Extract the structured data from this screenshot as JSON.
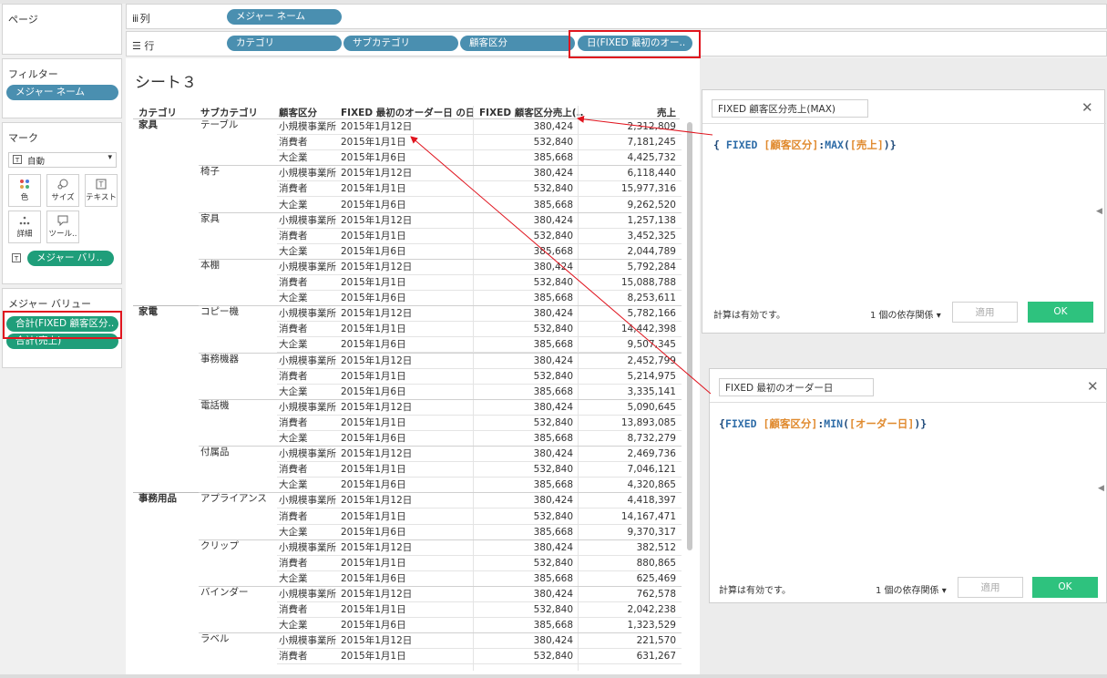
{
  "left": {
    "pages_title": "ページ",
    "filters_title": "フィルター",
    "filter_pill": "メジャー ネーム",
    "marks_title": "マーク",
    "mark_type": "自動",
    "mark_buttons": {
      "color": "色",
      "size": "サイズ",
      "text": "テキスト",
      "detail": "詳細",
      "tooltip": "ツール.."
    },
    "mark_pill": "メジャー バリ..",
    "measure_values_title": "メジャー バリュー",
    "measure_pills": [
      "合計(FIXED 顧客区分..",
      "合計(売上)"
    ]
  },
  "shelves": {
    "columns_label": "列",
    "columns_pills": [
      "メジャー ネーム"
    ],
    "rows_label": "行",
    "rows_pills": [
      "カテゴリ",
      "サブカテゴリ",
      "顧客区分",
      "日(FIXED 最初のオー.."
    ]
  },
  "sheet": {
    "title": "シート３",
    "headers": [
      "カテゴリ",
      "サブカテゴリ",
      "顧客区分",
      "FIXED 最初のオーダー日 の日",
      "FIXED 顧客区分売上(..",
      "売上"
    ],
    "categories": [
      {
        "name": "家具",
        "row": 0
      },
      {
        "name": "家電",
        "row": 12
      },
      {
        "name": "事務用品",
        "row": 24
      }
    ],
    "subcategories": [
      {
        "name": "テーブル",
        "row": 0
      },
      {
        "name": "椅子",
        "row": 3
      },
      {
        "name": "家具",
        "row": 6
      },
      {
        "name": "本棚",
        "row": 9
      },
      {
        "name": "コピー機",
        "row": 12
      },
      {
        "name": "事務機器",
        "row": 15
      },
      {
        "name": "電話機",
        "row": 18
      },
      {
        "name": "付属品",
        "row": 21
      },
      {
        "name": "アプライアンス",
        "row": 24
      },
      {
        "name": "クリップ",
        "row": 27
      },
      {
        "name": "バインダー",
        "row": 30
      },
      {
        "name": "ラベル",
        "row": 33
      }
    ],
    "rows": [
      [
        "小規模事業所",
        "2015年1月12日",
        "380,424",
        "2,312,809"
      ],
      [
        "消費者",
        "2015年1月1日",
        "532,840",
        "7,181,245"
      ],
      [
        "大企業",
        "2015年1月6日",
        "385,668",
        "4,425,732"
      ],
      [
        "小規模事業所",
        "2015年1月12日",
        "380,424",
        "6,118,440"
      ],
      [
        "消費者",
        "2015年1月1日",
        "532,840",
        "15,977,316"
      ],
      [
        "大企業",
        "2015年1月6日",
        "385,668",
        "9,262,520"
      ],
      [
        "小規模事業所",
        "2015年1月12日",
        "380,424",
        "1,257,138"
      ],
      [
        "消費者",
        "2015年1月1日",
        "532,840",
        "3,452,325"
      ],
      [
        "大企業",
        "2015年1月6日",
        "385,668",
        "2,044,789"
      ],
      [
        "小規模事業所",
        "2015年1月12日",
        "380,424",
        "5,792,284"
      ],
      [
        "消費者",
        "2015年1月1日",
        "532,840",
        "15,088,788"
      ],
      [
        "大企業",
        "2015年1月6日",
        "385,668",
        "8,253,611"
      ],
      [
        "小規模事業所",
        "2015年1月12日",
        "380,424",
        "5,782,166"
      ],
      [
        "消費者",
        "2015年1月1日",
        "532,840",
        "14,442,398"
      ],
      [
        "大企業",
        "2015年1月6日",
        "385,668",
        "9,507,345"
      ],
      [
        "小規模事業所",
        "2015年1月12日",
        "380,424",
        "2,452,799"
      ],
      [
        "消費者",
        "2015年1月1日",
        "532,840",
        "5,214,975"
      ],
      [
        "大企業",
        "2015年1月6日",
        "385,668",
        "3,335,141"
      ],
      [
        "小規模事業所",
        "2015年1月12日",
        "380,424",
        "5,090,645"
      ],
      [
        "消費者",
        "2015年1月1日",
        "532,840",
        "13,893,085"
      ],
      [
        "大企業",
        "2015年1月6日",
        "385,668",
        "8,732,279"
      ],
      [
        "小規模事業所",
        "2015年1月12日",
        "380,424",
        "2,469,736"
      ],
      [
        "消費者",
        "2015年1月1日",
        "532,840",
        "7,046,121"
      ],
      [
        "大企業",
        "2015年1月6日",
        "385,668",
        "4,320,865"
      ],
      [
        "小規模事業所",
        "2015年1月12日",
        "380,424",
        "4,418,397"
      ],
      [
        "消費者",
        "2015年1月1日",
        "532,840",
        "14,167,471"
      ],
      [
        "大企業",
        "2015年1月6日",
        "385,668",
        "9,370,317"
      ],
      [
        "小規模事業所",
        "2015年1月12日",
        "380,424",
        "382,512"
      ],
      [
        "消費者",
        "2015年1月1日",
        "532,840",
        "880,865"
      ],
      [
        "大企業",
        "2015年1月6日",
        "385,668",
        "625,469"
      ],
      [
        "小規模事業所",
        "2015年1月12日",
        "380,424",
        "762,578"
      ],
      [
        "消費者",
        "2015年1月1日",
        "532,840",
        "2,042,238"
      ],
      [
        "大企業",
        "2015年1月6日",
        "385,668",
        "1,323,529"
      ],
      [
        "小規模事業所",
        "2015年1月12日",
        "380,424",
        "221,570"
      ],
      [
        "消費者",
        "2015年1月1日",
        "532,840",
        "631,267"
      ]
    ]
  },
  "dialog1": {
    "name": "FIXED 顧客区分売上(MAX)",
    "formula": {
      "open": "{ ",
      "kw": "FIXED ",
      "field1": "[顧客区分]",
      "colon": ":",
      "fn": "MAX",
      "p1": "(",
      "field2": "[売上]",
      "close": ")}"
    },
    "status": "計算は有効です。",
    "deps": "1 個の依存関係",
    "apply": "適用",
    "ok": "OK"
  },
  "dialog2": {
    "name": "FIXED 最初のオーダー日",
    "formula": {
      "open": "{",
      "kw": "FIXED ",
      "field1": "[顧客区分]",
      "colon": ":",
      "fn": "MIN",
      "p1": "(",
      "field2": "[オーダー日]",
      "close": ")}"
    },
    "status": "計算は有効です。",
    "deps": "1 個の依存関係",
    "apply": "適用",
    "ok": "OK"
  },
  "colors": {
    "green_pill": "#1f9e7a",
    "blue_pill": "#4a8fb0",
    "highlight": "#e0141e",
    "ok_button": "#2ec27e"
  },
  "icons": [
    "columns-icon",
    "rows-icon",
    "text-mark-icon",
    "dropdown-icon",
    "color-icon",
    "size-icon",
    "text-icon",
    "detail-icon",
    "tooltip-icon",
    "close-icon"
  ]
}
